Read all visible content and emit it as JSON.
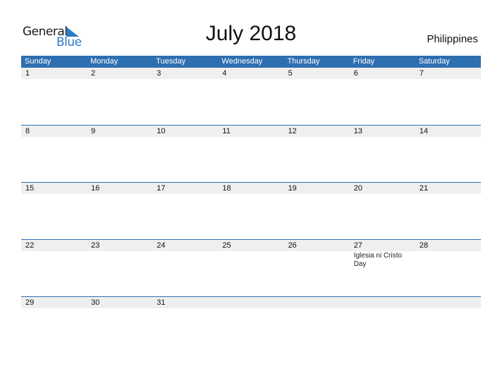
{
  "logo": {
    "line1": "General",
    "line2": "Blue"
  },
  "header": {
    "title": "July 2018",
    "country": "Philippines"
  },
  "colors": {
    "accent": "#2e6fb0",
    "date_strip": "#efefef",
    "logo_blue": "#2a7bc4"
  },
  "weekdays": [
    "Sunday",
    "Monday",
    "Tuesday",
    "Wednesday",
    "Thursday",
    "Friday",
    "Saturday"
  ],
  "weeks": [
    {
      "days": [
        "1",
        "2",
        "3",
        "4",
        "5",
        "6",
        "7"
      ],
      "events": [
        "",
        "",
        "",
        "",
        "",
        "",
        ""
      ]
    },
    {
      "days": [
        "8",
        "9",
        "10",
        "11",
        "12",
        "13",
        "14"
      ],
      "events": [
        "",
        "",
        "",
        "",
        "",
        "",
        ""
      ]
    },
    {
      "days": [
        "15",
        "16",
        "17",
        "18",
        "19",
        "20",
        "21"
      ],
      "events": [
        "",
        "",
        "",
        "",
        "",
        "",
        ""
      ]
    },
    {
      "days": [
        "22",
        "23",
        "24",
        "25",
        "26",
        "27",
        "28"
      ],
      "events": [
        "",
        "",
        "",
        "",
        "",
        "Iglesia ni Cristo Day",
        ""
      ]
    },
    {
      "days": [
        "29",
        "30",
        "31",
        "",
        "",
        "",
        ""
      ],
      "events": [
        "",
        "",
        "",
        "",
        "",
        "",
        ""
      ]
    }
  ]
}
